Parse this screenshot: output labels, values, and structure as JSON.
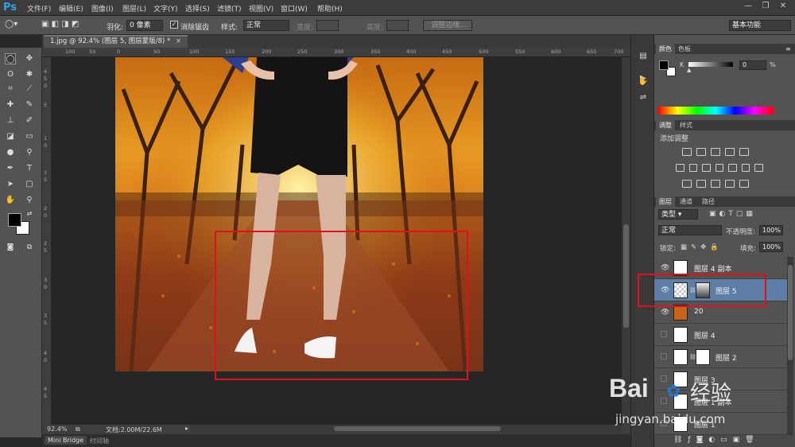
{
  "app": {
    "logo": "Ps"
  },
  "menu": [
    "文件(F)",
    "编辑(E)",
    "图像(I)",
    "图层(L)",
    "文字(Y)",
    "选择(S)",
    "滤镜(T)",
    "视图(V)",
    "窗口(W)",
    "帮助(H)"
  ],
  "options": {
    "feather_label": "羽化:",
    "feather_value": "0 像素",
    "antialias_label": "消除锯齿",
    "style_label": "样式:",
    "style_value": "正常",
    "width_label": "宽度:",
    "height_label": "高度:",
    "refine_edge": "调整边缘...",
    "workspace": "基本功能"
  },
  "document": {
    "tab_title": "1.jpg @ 92.4% (图层 5, 图层蒙版/8) *"
  },
  "rulers": {
    "top": [
      "100",
      "50",
      "0",
      "50",
      "100",
      "150",
      "200",
      "250",
      "300",
      "350",
      "400",
      "450",
      "500",
      "550",
      "600",
      "650",
      "700"
    ],
    "left": [
      "4",
      "5",
      "0",
      "5",
      "1",
      "0",
      "1",
      "5",
      "2",
      "0",
      "2",
      "5",
      "3",
      "0",
      "3",
      "5",
      "4",
      "0",
      "4",
      "5"
    ]
  },
  "status": {
    "zoom": "92.4%",
    "doc_info": "文档:2.00M/22.6M"
  },
  "bottom_tabs": [
    "Mini Bridge",
    "时间轴"
  ],
  "color_panel": {
    "tabs": [
      "颜色",
      "色板"
    ],
    "channel_label": "K",
    "value": "0",
    "unit": "%"
  },
  "adjust_panel": {
    "tabs": [
      "调整",
      "样式"
    ],
    "title": "添加调整"
  },
  "layers_panel": {
    "tabs": [
      "图层",
      "通道",
      "路径"
    ],
    "filter_label": "类型",
    "blend_mode": "正常",
    "opacity_label": "不透明度:",
    "opacity_value": "100%",
    "lock_label": "锁定:",
    "fill_label": "填充:",
    "fill_value": "100%",
    "layers": [
      {
        "name": "图层 4 副本",
        "visible": true
      },
      {
        "name": "图层 5",
        "visible": true,
        "selected": true
      },
      {
        "name": "20",
        "visible": true
      },
      {
        "name": "图层 4",
        "visible": false
      },
      {
        "name": "图层 2",
        "visible": false
      },
      {
        "name": "图层 3",
        "visible": false
      },
      {
        "name": "图层 1 副本",
        "visible": false
      },
      {
        "name": "图层 1",
        "visible": false
      }
    ]
  },
  "watermark": {
    "line1": "Bai",
    "line2": "经验",
    "line3": "jingyan.baidu.com"
  },
  "colors": {
    "highlight": "#e3101c",
    "selected_layer": "#5d7ea6",
    "ps_blue": "#2fa3e8"
  }
}
